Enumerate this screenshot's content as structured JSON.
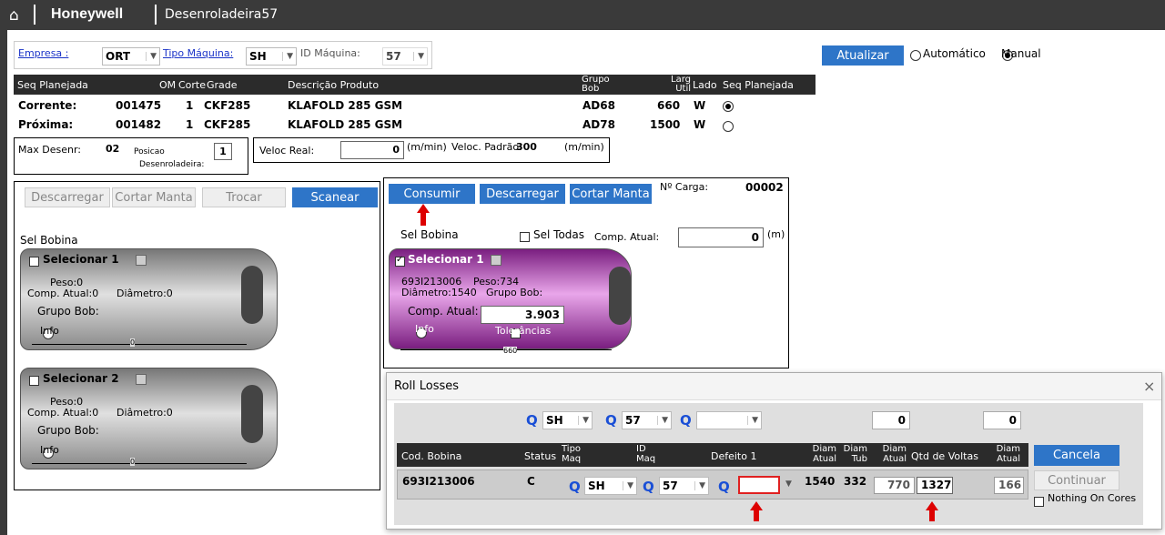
{
  "topbar": {
    "brand": "Honeywell",
    "title": "Desenroladeira57"
  },
  "filters": {
    "empresa_label": "Empresa :",
    "empresa_value": "ORT",
    "tipo_label": "Tipo Máquina:",
    "tipo_value": "SH",
    "id_label": "ID Máquina:",
    "id_value": "57"
  },
  "actions": {
    "atualizar": "Atualizar",
    "auto": "Automático",
    "manual": "Manual"
  },
  "table": {
    "headers": [
      "Seq Planejada",
      "OM",
      "Corte",
      "Grade",
      "Descrição Produto",
      "Grupo Bob",
      "Larg Util",
      "Lado",
      "Seq Planejada"
    ],
    "rows": [
      {
        "label": "Corrente:",
        "om": "001475",
        "corte": "1",
        "grade": "CKF285",
        "desc": "KLAFOLD 285 GSM",
        "grupo": "AD68",
        "larg": "660",
        "lado": "W"
      },
      {
        "label": "Próxima:",
        "om": "001482",
        "corte": "1",
        "grade": "CKF285",
        "desc": "KLAFOLD 285 GSM",
        "grupo": "AD78",
        "larg": "1500",
        "lado": "W"
      }
    ]
  },
  "info": {
    "max_label": "Max Desenr:",
    "max_value": "02",
    "pos_label1": "Posicao",
    "pos_label2": "Desenroladeira:",
    "pos_value": "1",
    "veloc_real_label": "Veloc Real:",
    "veloc_real_value": "0",
    "unit1": "(m/min)",
    "veloc_padrao_label": "Veloc. Padrão:",
    "veloc_padrao_value": "300",
    "unit2": "(m/min)"
  },
  "left_panel": {
    "descarregar": "Descarregar",
    "cortar": "Cortar Manta",
    "trocar": "Trocar",
    "scanear": "Scanear",
    "sel_bobina": "Sel Bobina",
    "bobinas": [
      {
        "sel": "Selecionar 1",
        "peso": "Peso:0",
        "comp": "Comp. Atual:0",
        "diam": "Diâmetro:0",
        "grupo": "Grupo Bob:",
        "info": "Info",
        "width": "0"
      },
      {
        "sel": "Selecionar 2",
        "peso": "Peso:0",
        "comp": "Comp. Atual:0",
        "diam": "Diâmetro:0",
        "grupo": "Grupo Bob:",
        "info": "Info",
        "width": "0"
      }
    ]
  },
  "right_panel": {
    "consumir": "Consumir",
    "descarregar": "Descarregar",
    "cortar": "Cortar Manta",
    "carga_label": "Nº Carga:",
    "carga_value": "00002",
    "sel_bobina": "Sel Bobina",
    "sel_todas": "Sel Todas",
    "comp_label": "Comp. Atual:",
    "comp_value": "0",
    "comp_unit": "(m)",
    "bobina": {
      "sel": "Selecionar 1",
      "code": "693I213006",
      "peso": "Peso:734",
      "diam": "Diâmetro:1540",
      "grupo": "Grupo Bob:",
      "comp_label": "Comp. Atual:",
      "comp_value": "3.903",
      "info": "Info",
      "tolerancias": "Tolerâncias",
      "width": "660"
    }
  },
  "dialog": {
    "title": "Roll Losses",
    "close": "×",
    "f_tipo": "SH",
    "f_id": "57",
    "f_def": "",
    "f_n1": "0",
    "f_n2": "0",
    "headers": [
      "Cod. Bobina",
      "Status",
      "Tipo Maq",
      "ID Maq",
      "Defeito 1",
      "Diam Atual",
      "Diam Tub",
      "Diam Atual",
      "Qtd de Voltas",
      "Diam Atual"
    ],
    "row": {
      "cod": "693I213006",
      "status": "C",
      "tipo": "SH",
      "id": "57",
      "defeito": "",
      "diam1": "1540",
      "tub": "332",
      "diam2": "770",
      "voltas": "1327",
      "diam3": "166"
    },
    "cancela": "Cancela",
    "continuar": "Continuar",
    "nothing": "Nothing On Cores"
  }
}
